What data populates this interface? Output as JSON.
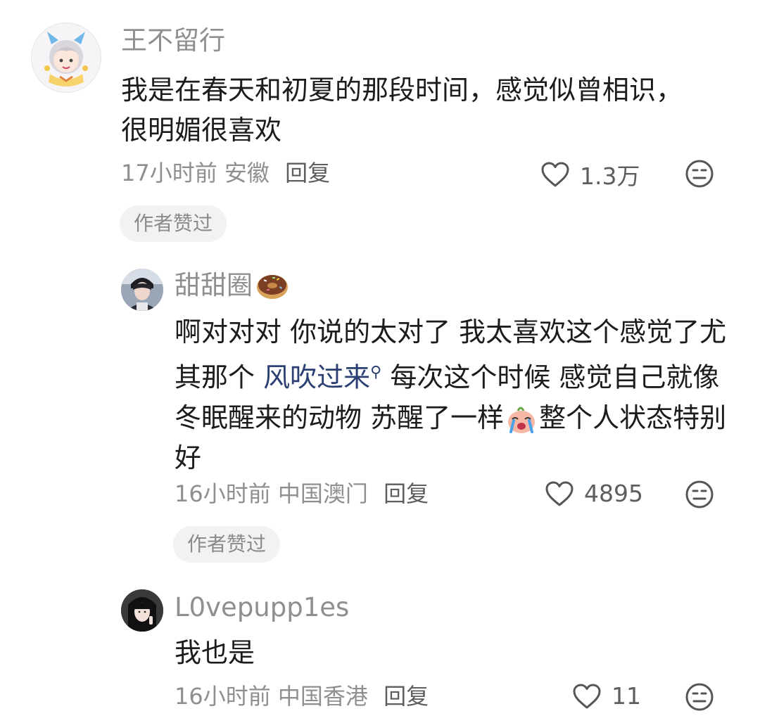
{
  "comments": [
    {
      "username": "王不留行",
      "text": "我是在春天和初夏的那段时间，感觉似曾相识，很明媚很喜欢",
      "time": "17小时前",
      "location": "安徽",
      "reply_label": "回复",
      "likes": "1.3万",
      "badge": "作者赞过",
      "avatar_icon": "anime-avatar"
    },
    {
      "username": "甜甜圈",
      "username_emoji": "donut-emoji",
      "text_part1": "啊对对对 你说的太对了 我太喜欢这个感觉了尤其那个 ",
      "link_text": "风吹过来",
      "text_part2": " 每次这个时候 感觉自己就像冬眠醒来的动物 苏醒了一样",
      "text_part3": "整个人状态特别好",
      "inline_emoji": "crying-emoji",
      "time": "16小时前",
      "location": "中国澳门",
      "reply_label": "回复",
      "likes": "4895",
      "badge": "作者赞过",
      "avatar_icon": "photo-avatar"
    },
    {
      "username": "L0vepupp1es",
      "text": "我也是",
      "time": "16小时前",
      "location": "中国香港",
      "reply_label": "回复",
      "likes": "11",
      "avatar_icon": "photo-avatar"
    }
  ],
  "colors": {
    "username": "#8f8f8f",
    "link": "#2b3f73",
    "badge_bg": "#f2f2f2"
  }
}
